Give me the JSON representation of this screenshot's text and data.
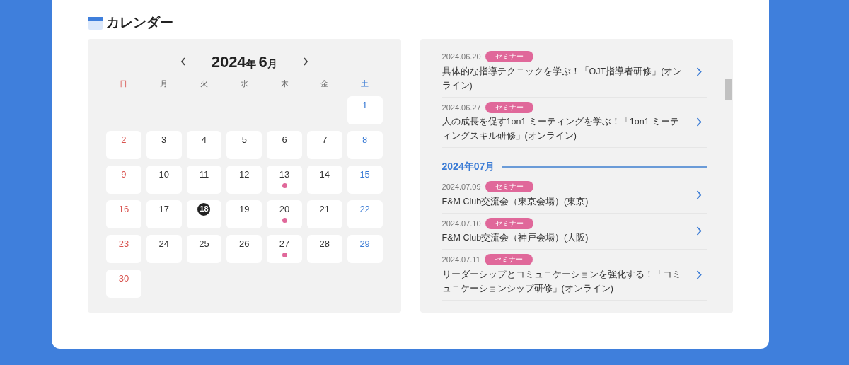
{
  "heading": "カレンダー",
  "calendar": {
    "year": "2024",
    "year_unit": "年",
    "month": "6",
    "month_unit": "月",
    "weekdays": [
      "日",
      "月",
      "火",
      "水",
      "木",
      "金",
      "土"
    ],
    "weeks": [
      [
        {
          "day": "1",
          "event": false,
          "today": false
        }
      ],
      [
        {
          "day": "2",
          "event": false,
          "today": false
        },
        {
          "day": "3",
          "event": false,
          "today": false
        },
        {
          "day": "4",
          "event": false,
          "today": false
        },
        {
          "day": "5",
          "event": false,
          "today": false
        },
        {
          "day": "6",
          "event": false,
          "today": false
        },
        {
          "day": "7",
          "event": false,
          "today": false
        },
        {
          "day": "8",
          "event": false,
          "today": false
        }
      ],
      [
        {
          "day": "9",
          "event": false,
          "today": false
        },
        {
          "day": "10",
          "event": false,
          "today": false
        },
        {
          "day": "11",
          "event": false,
          "today": false
        },
        {
          "day": "12",
          "event": false,
          "today": false
        },
        {
          "day": "13",
          "event": true,
          "today": false
        },
        {
          "day": "14",
          "event": false,
          "today": false
        },
        {
          "day": "15",
          "event": false,
          "today": false
        }
      ],
      [
        {
          "day": "16",
          "event": false,
          "today": false
        },
        {
          "day": "17",
          "event": false,
          "today": false
        },
        {
          "day": "18",
          "event": false,
          "today": true
        },
        {
          "day": "19",
          "event": false,
          "today": false
        },
        {
          "day": "20",
          "event": true,
          "today": false
        },
        {
          "day": "21",
          "event": false,
          "today": false
        },
        {
          "day": "22",
          "event": false,
          "today": false
        }
      ],
      [
        {
          "day": "23",
          "event": false,
          "today": false
        },
        {
          "day": "24",
          "event": false,
          "today": false
        },
        {
          "day": "25",
          "event": false,
          "today": false
        },
        {
          "day": "26",
          "event": false,
          "today": false
        },
        {
          "day": "27",
          "event": true,
          "today": false
        },
        {
          "day": "28",
          "event": false,
          "today": false
        },
        {
          "day": "29",
          "event": false,
          "today": false
        }
      ],
      [
        {
          "day": "30",
          "event": false,
          "today": false
        }
      ]
    ]
  },
  "events": [
    {
      "kind": "event",
      "date": "2024.06.20",
      "tag": "セミナー",
      "title": "具体的な指導テクニックを学ぶ！「OJT指導者研修」(オンライン)"
    },
    {
      "kind": "event",
      "date": "2024.06.27",
      "tag": "セミナー",
      "title": "人の成長を促す1on1 ミーティングを学ぶ！「1on1 ミーティングスキル研修」(オンライン)"
    },
    {
      "kind": "month",
      "label": "2024年07月"
    },
    {
      "kind": "event",
      "date": "2024.07.09",
      "tag": "セミナー",
      "title": "F&M Club交流会（東京会場）(東京)"
    },
    {
      "kind": "event",
      "date": "2024.07.10",
      "tag": "セミナー",
      "title": "F&M Club交流会（神戸会場）(大阪)"
    },
    {
      "kind": "event",
      "date": "2024.07.11",
      "tag": "セミナー",
      "title": "リーダーシップとコミュニケーションを強化する！「コミュニケーションシップ研修」(オンライン)"
    }
  ]
}
